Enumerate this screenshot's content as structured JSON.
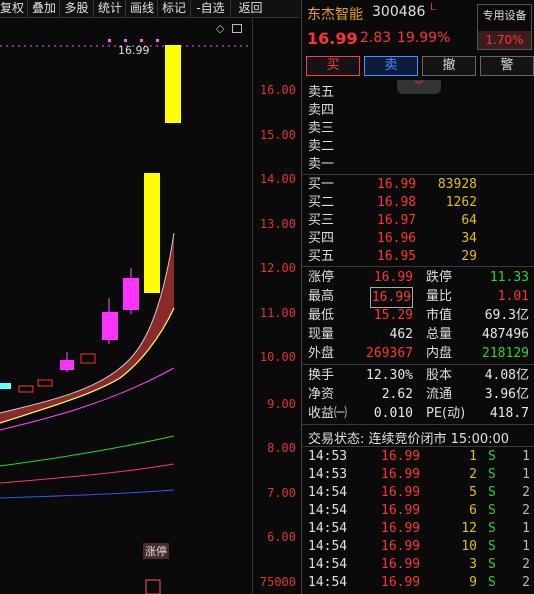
{
  "toolbar": {
    "items": [
      "复权",
      "叠加",
      "多股",
      "统计",
      "画线",
      "标记",
      "-自选",
      "返回"
    ]
  },
  "chart": {
    "price_axis": [
      "16.00",
      "15.00",
      "14.00",
      "13.00",
      "12.00",
      "11.00",
      "10.00",
      "9.00",
      "8.00",
      "7.00",
      "6.00"
    ],
    "volume_axis": "75000",
    "high_marker": "16.99",
    "limit_tag": "涨停",
    "colors": {
      "up": "#ff00ff",
      "limit_up": "#ffff00",
      "axis": "#d33"
    }
  },
  "stock": {
    "name": "东杰智能",
    "code": "300486",
    "flag": "L",
    "price": "16.99",
    "change": "2.83",
    "change_pct": "19.99%",
    "special_title": "专用设备",
    "special_value": "1.70%"
  },
  "actions": {
    "buy": "买",
    "sell": "卖",
    "cancel": "撤",
    "warn": "警"
  },
  "ask": [
    {
      "label": "卖五",
      "price": "",
      "volume": ""
    },
    {
      "label": "卖四",
      "price": "",
      "volume": ""
    },
    {
      "label": "卖三",
      "price": "",
      "volume": ""
    },
    {
      "label": "卖二",
      "price": "",
      "volume": ""
    },
    {
      "label": "卖一",
      "price": "",
      "volume": ""
    }
  ],
  "bid": [
    {
      "label": "买一",
      "price": "16.99",
      "volume": "83928"
    },
    {
      "label": "买二",
      "price": "16.98",
      "volume": "1262"
    },
    {
      "label": "买三",
      "price": "16.97",
      "volume": "64"
    },
    {
      "label": "买四",
      "price": "16.96",
      "volume": "34"
    },
    {
      "label": "买五",
      "price": "16.95",
      "volume": "29"
    }
  ],
  "stats": [
    {
      "l1": "涨停",
      "v1": "16.99",
      "c1": "red",
      "l2": "跌停",
      "v2": "11.33",
      "c2": "green"
    },
    {
      "l1": "最高",
      "v1": "16.99",
      "c1": "red",
      "l2": "量比",
      "v2": "1.01",
      "c2": "red"
    },
    {
      "l1": "最低",
      "v1": "15.29",
      "c1": "red",
      "l2": "市值",
      "v2": "69.3亿",
      "c2": "white"
    },
    {
      "l1": "现量",
      "v1": "462",
      "c1": "white",
      "l2": "总量",
      "v2": "487496",
      "c2": "white"
    },
    {
      "l1": "外盘",
      "v1": "269367",
      "c1": "red",
      "l2": "内盘",
      "v2": "218129",
      "c2": "green"
    }
  ],
  "stats2": [
    {
      "l1": "换手",
      "v1": "12.30%",
      "l2": "股本",
      "v2": "4.08亿"
    },
    {
      "l1": "净资",
      "v1": "2.62",
      "l2": "流通",
      "v2": "3.96亿"
    },
    {
      "l1": "收益㈠",
      "v1": "0.010",
      "l2": "PE(动)",
      "v2": "418.7"
    }
  ],
  "status": "交易状态: 连续竞价闭市 15:00:00",
  "ticks": [
    {
      "time": "14:53",
      "price": "16.99",
      "vol": "1",
      "side": "S",
      "cnt": "1"
    },
    {
      "time": "14:53",
      "price": "16.99",
      "vol": "2",
      "side": "S",
      "cnt": "1"
    },
    {
      "time": "14:54",
      "price": "16.99",
      "vol": "5",
      "side": "S",
      "cnt": "2"
    },
    {
      "time": "14:54",
      "price": "16.99",
      "vol": "6",
      "side": "S",
      "cnt": "2"
    },
    {
      "time": "14:54",
      "price": "16.99",
      "vol": "12",
      "side": "S",
      "cnt": "1"
    },
    {
      "time": "14:54",
      "price": "16.99",
      "vol": "10",
      "side": "S",
      "cnt": "1"
    },
    {
      "time": "14:54",
      "price": "16.99",
      "vol": "3",
      "side": "S",
      "cnt": "2"
    },
    {
      "time": "14:54",
      "price": "16.99",
      "vol": "9",
      "side": "S",
      "cnt": "2"
    }
  ]
}
